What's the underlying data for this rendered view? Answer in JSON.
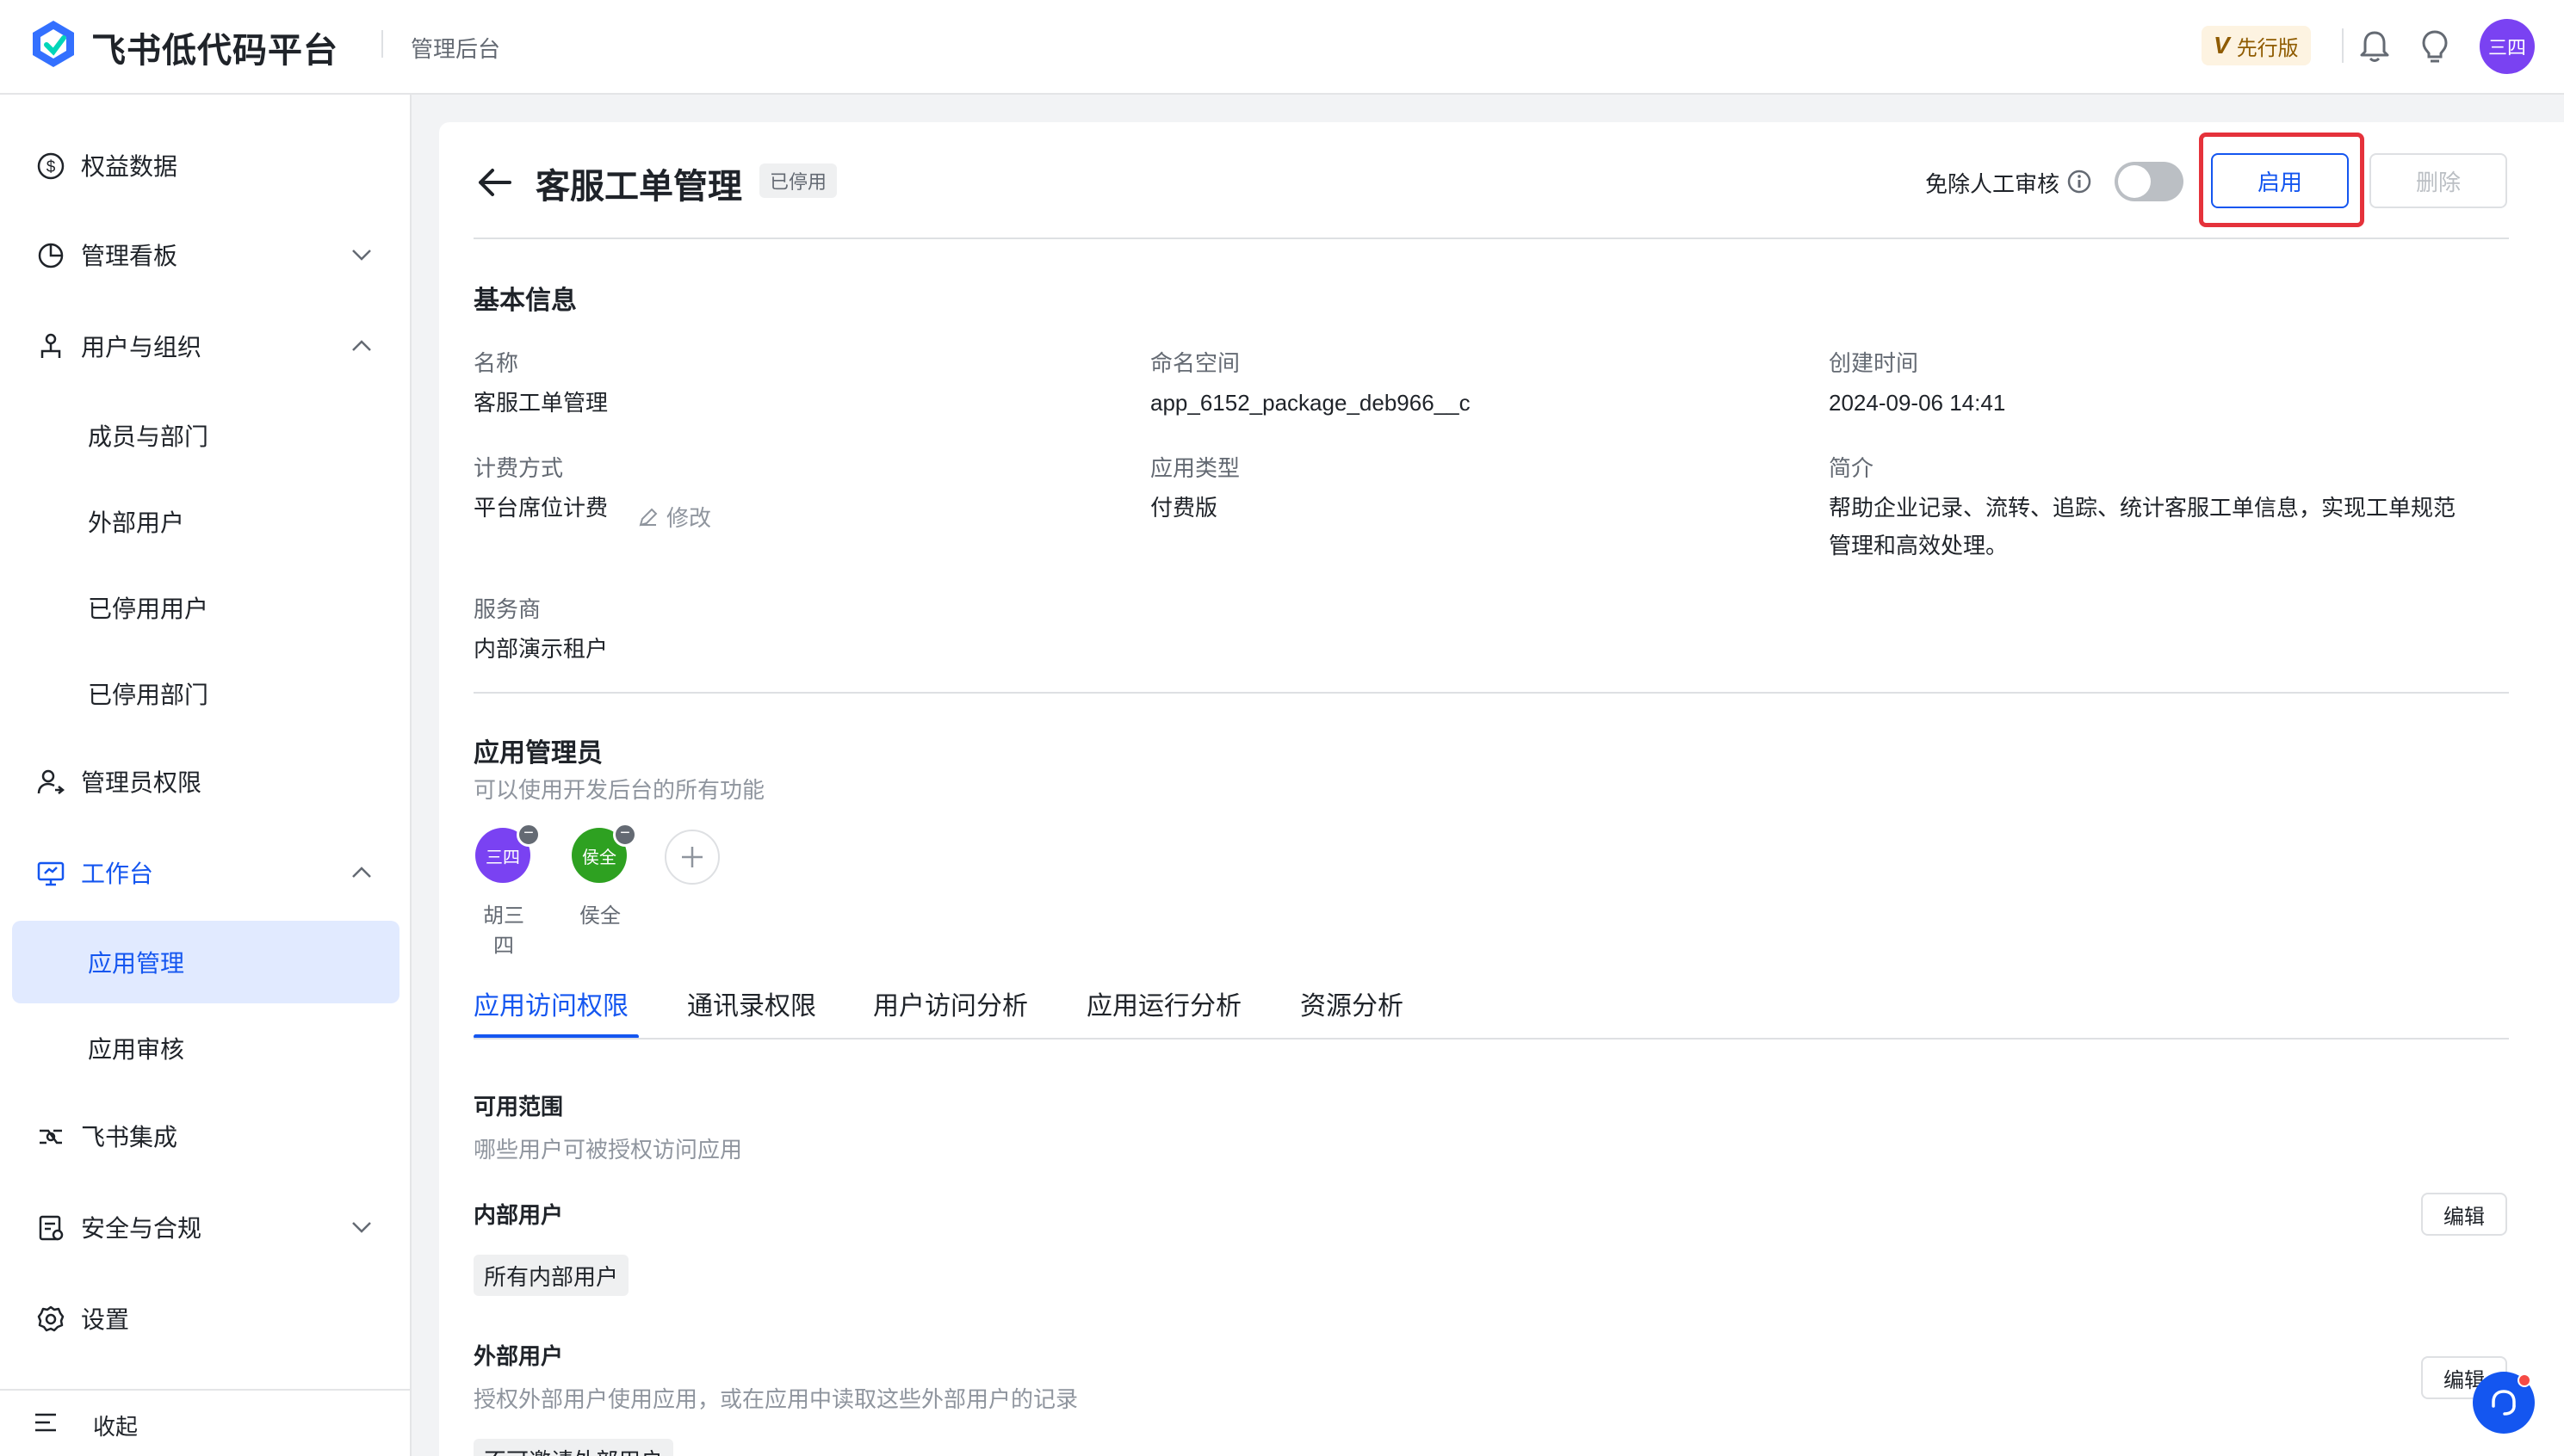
{
  "header": {
    "brand": "飞书低代码平台",
    "subtitle": "管理后台",
    "plan_badge": "先行版",
    "plan_badge_letter": "V",
    "avatar_text": "三四",
    "icons": [
      "bell-icon",
      "lightbulb-icon"
    ]
  },
  "sidebar": {
    "items": [
      {
        "label": "权益数据",
        "icon": "dollar-circle-icon"
      },
      {
        "label": "管理看板",
        "icon": "pie-chart-icon",
        "chevron": "down"
      },
      {
        "label": "用户与组织",
        "icon": "org-icon",
        "chevron": "up"
      },
      {
        "label": "成员与部门"
      },
      {
        "label": "外部用户"
      },
      {
        "label": "已停用用户"
      },
      {
        "label": "已停用部门"
      },
      {
        "label": "管理员权限",
        "icon": "admin-user-icon"
      },
      {
        "label": "工作台",
        "icon": "monitor-icon",
        "chevron": "up"
      },
      {
        "label": "应用管理",
        "selected": true
      },
      {
        "label": "应用审核"
      },
      {
        "label": "飞书集成",
        "icon": "integration-icon"
      },
      {
        "label": "安全与合规",
        "icon": "shield-icon",
        "chevron": "down"
      },
      {
        "label": "设置",
        "icon": "gear-icon"
      }
    ],
    "collapse_label": "收起"
  },
  "page": {
    "title": "客服工单管理",
    "status": "已停用",
    "exempt_review_label": "免除人工审核",
    "exempt_review_enabled": false,
    "enable_button": "启用",
    "delete_button": "删除"
  },
  "basic_info": {
    "title": "基本信息",
    "name_label": "名称",
    "name_value": "客服工单管理",
    "namespace_label": "命名空间",
    "namespace_value": "app_6152_package_deb966__c",
    "created_label": "创建时间",
    "created_value": "2024-09-06 14:41",
    "billing_label": "计费方式",
    "billing_value": "平台席位计费",
    "billing_edit": "修改",
    "app_type_label": "应用类型",
    "app_type_value": "付费版",
    "intro_label": "简介",
    "intro_value_line1": "帮助企业记录、流转、追踪、统计客服工单信息，实现工单规范",
    "intro_value_line2": "管理和高效处理。",
    "provider_label": "服务商",
    "provider_value": "内部演示租户"
  },
  "admins": {
    "title": "应用管理员",
    "desc": "可以使用开发后台的所有功能",
    "list": [
      {
        "avatar": "三四",
        "name": "胡三四",
        "color": "#7a42f2"
      },
      {
        "avatar": "侯全",
        "name": "侯全",
        "color": "#2ea121"
      }
    ]
  },
  "tabs": [
    "应用访问权限",
    "通讯录权限",
    "用户访问分析",
    "应用运行分析",
    "资源分析"
  ],
  "access": {
    "scope_title": "可用范围",
    "scope_desc": "哪些用户可被授权访问应用",
    "internal_title": "内部用户",
    "internal_tag": "所有内部用户",
    "external_title": "外部用户",
    "external_desc": "授权外部用户使用应用，或在应用中读取这些外部用户的记录",
    "external_tag": "不可邀请外部用户",
    "edit_label": "编辑"
  },
  "colors": {
    "accent": "#1456f0",
    "selected_bg": "#e1eaff",
    "highlight": "#e5323b"
  }
}
